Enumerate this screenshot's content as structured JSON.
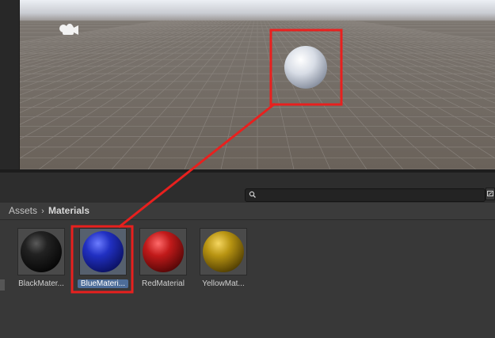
{
  "breadcrumb": {
    "root": "Assets",
    "separator": "›",
    "current": "Materials"
  },
  "search": {
    "placeholder": "",
    "value": ""
  },
  "assets": [
    {
      "label": "BlackMater...",
      "color": "#1a1a1a"
    },
    {
      "label": "BlueMateri...",
      "color": "#1e2fb0",
      "selected": true
    },
    {
      "label": "RedMaterial",
      "color": "#b01818"
    },
    {
      "label": "YellowMat...",
      "color": "#b0900f"
    }
  ],
  "scene": {
    "sky_color": "#dfe3ea",
    "ground_color": "#6e665e",
    "sphere_color": "#e6eaf2"
  },
  "annotation": {
    "color": "#e8201e"
  }
}
